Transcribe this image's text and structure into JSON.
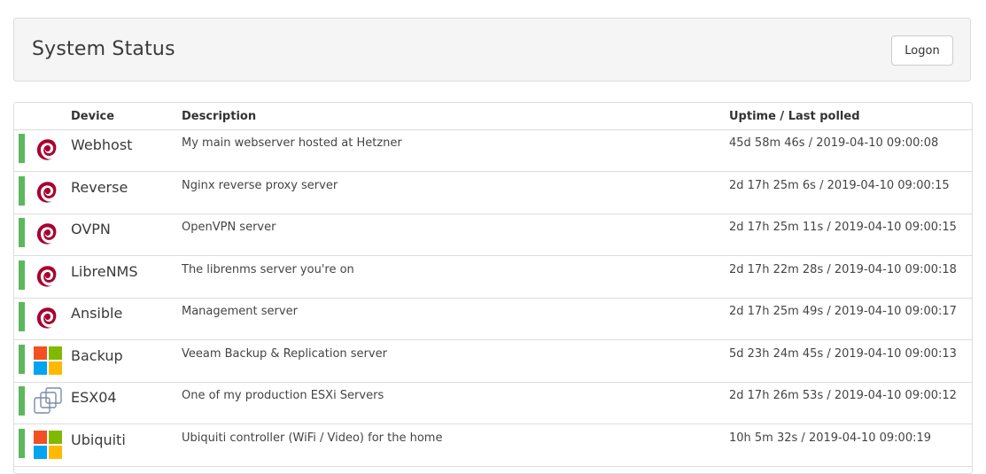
{
  "header": {
    "title": "System Status",
    "logon_label": "Logon"
  },
  "table": {
    "columns": {
      "device": "Device",
      "description": "Description",
      "uptime": "Uptime / Last polled"
    },
    "status_color": "#5cb85c",
    "rows": [
      {
        "name": "Webhost",
        "icon": "debian-icon",
        "description": "My main webserver hosted at Hetzner",
        "uptime": "45d 58m 46s / 2019-04-10 09:00:08"
      },
      {
        "name": "Reverse",
        "icon": "debian-icon",
        "description": "Nginx reverse proxy server",
        "uptime": "2d 17h 25m 6s / 2019-04-10 09:00:15"
      },
      {
        "name": "OVPN",
        "icon": "debian-icon",
        "description": "OpenVPN server",
        "uptime": "2d 17h 25m 11s / 2019-04-10 09:00:15"
      },
      {
        "name": "LibreNMS",
        "icon": "debian-icon",
        "description": "The librenms server you're on",
        "uptime": "2d 17h 22m 28s / 2019-04-10 09:00:18"
      },
      {
        "name": "Ansible",
        "icon": "debian-icon",
        "description": "Management server",
        "uptime": "2d 17h 25m 49s / 2019-04-10 09:00:17"
      },
      {
        "name": "Backup",
        "icon": "windows-icon",
        "description": "Veeam Backup & Replication server",
        "uptime": "5d 23h 24m 45s / 2019-04-10 09:00:13"
      },
      {
        "name": "ESX04",
        "icon": "vmware-icon",
        "description": "One of my production ESXi Servers",
        "uptime": "2d 17h 26m 53s / 2019-04-10 09:00:12"
      },
      {
        "name": "Ubiquiti",
        "icon": "windows-icon",
        "description": "Ubiquiti controller (WiFi / Video) for the home",
        "uptime": "10h 5m 32s / 2019-04-10 09:00:19"
      }
    ]
  }
}
